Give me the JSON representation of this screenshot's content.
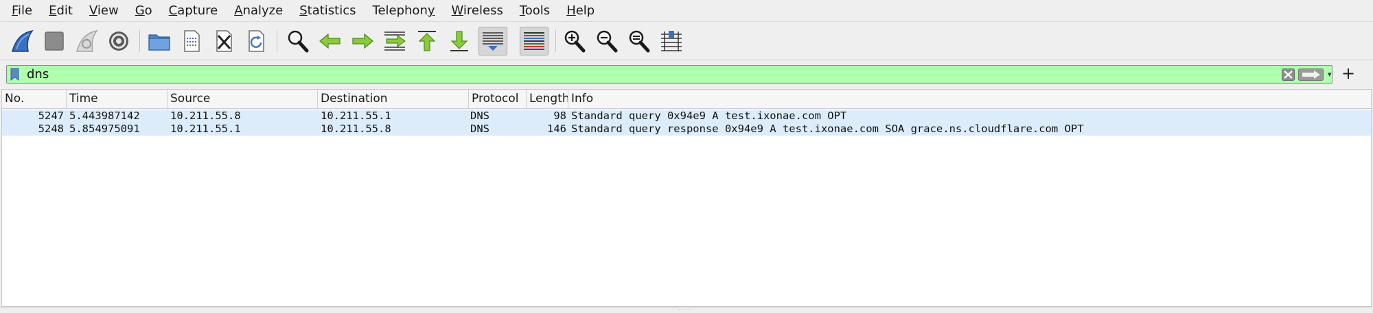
{
  "menu": {
    "items": [
      {
        "first": "F",
        "rest": "ile"
      },
      {
        "first": "E",
        "rest": "dit"
      },
      {
        "first": "V",
        "rest": "iew"
      },
      {
        "first": "G",
        "rest": "o"
      },
      {
        "first": "C",
        "rest": "apture"
      },
      {
        "first": "A",
        "rest": "nalyze"
      },
      {
        "first": "S",
        "rest": "tatistics"
      },
      {
        "first": "",
        "rest": "Telephon",
        "mid": "y"
      },
      {
        "first": "W",
        "rest": "ireless"
      },
      {
        "first": "T",
        "rest": "ools"
      },
      {
        "first": "H",
        "rest": "elp"
      }
    ]
  },
  "toolbar": {
    "icons": [
      "start-capture-icon",
      "stop-capture-icon",
      "restart-capture-icon",
      "capture-options-icon",
      "open-file-icon",
      "save-file-icon",
      "close-file-icon",
      "reload-file-icon",
      "find-packet-icon",
      "go-back-icon",
      "go-forward-icon",
      "go-to-packet-icon",
      "first-packet-icon",
      "last-packet-icon",
      "auto-scroll-icon",
      "colorize-icon",
      "zoom-in-icon",
      "zoom-out-icon",
      "normal-size-icon",
      "resize-columns-icon"
    ]
  },
  "filter": {
    "value": "dns",
    "background_color": "#afffaf"
  },
  "packet_list": {
    "columns": [
      "No.",
      "Time",
      "Source",
      "Destination",
      "Protocol",
      "Length",
      "Info"
    ],
    "rows": [
      {
        "no": "5247",
        "time": "5.443987142",
        "source": "10.211.55.8",
        "destination": "10.211.55.1",
        "protocol": "DNS",
        "length": "98",
        "info": "Standard query 0x94e9 A test.ixonae.com OPT"
      },
      {
        "no": "5248",
        "time": "5.854975091",
        "source": "10.211.55.1",
        "destination": "10.211.55.8",
        "protocol": "DNS",
        "length": "146",
        "info": "Standard query response 0x94e9 A test.ixonae.com SOA grace.ns.cloudflare.com OPT"
      }
    ],
    "row_color": "#dcecfb"
  }
}
